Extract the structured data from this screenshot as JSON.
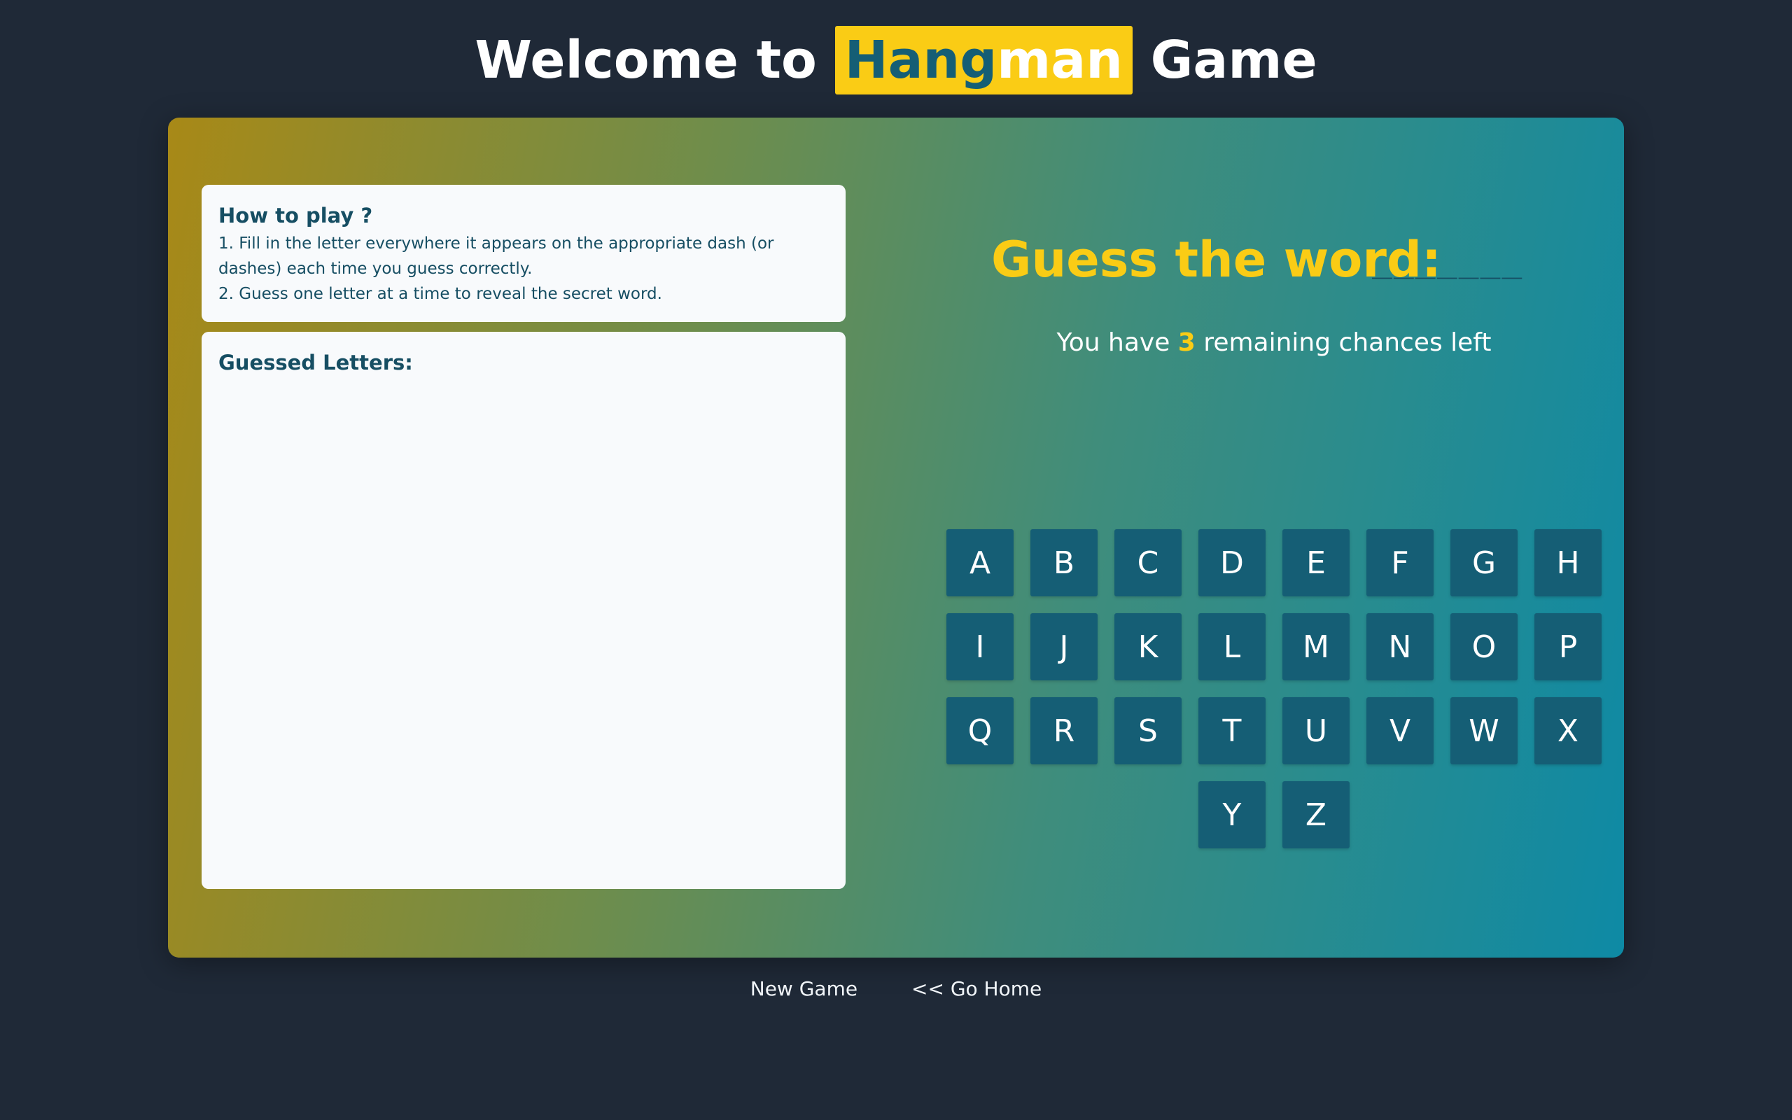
{
  "header": {
    "title_prefix": "Welcome to ",
    "title_highlight_a": "Hang",
    "title_highlight_b": "man",
    "title_suffix": " Game"
  },
  "how_to_play": {
    "heading": "How to play ?",
    "rule_1": "1. Fill in the letter everywhere it appears on the appropriate dash (or dashes) each time you guess correctly.",
    "rule_2": "2. Guess one letter at a time to reveal the secret word."
  },
  "guessed_letters": {
    "heading": "Guessed Letters:",
    "letters": ""
  },
  "game": {
    "guess_label": "Guess the word:",
    "word_mask": "_______",
    "chances_prefix": "You have ",
    "chances_count": "3",
    "chances_suffix": " remaining chances left"
  },
  "keyboard": {
    "rows": [
      [
        "A",
        "B",
        "C",
        "D",
        "E",
        "F",
        "G",
        "H"
      ],
      [
        "I",
        "J",
        "K",
        "L",
        "M",
        "N",
        "O",
        "P"
      ],
      [
        "Q",
        "R",
        "S",
        "T",
        "U",
        "V",
        "W",
        "X"
      ],
      [
        "Y",
        "Z"
      ]
    ]
  },
  "footer": {
    "new_game": "New Game",
    "go_home": "<< Go Home"
  },
  "colors": {
    "background": "#1f2937",
    "accent_yellow": "#facc15",
    "key_blue": "#155e75",
    "text_dark": "#164e63"
  }
}
